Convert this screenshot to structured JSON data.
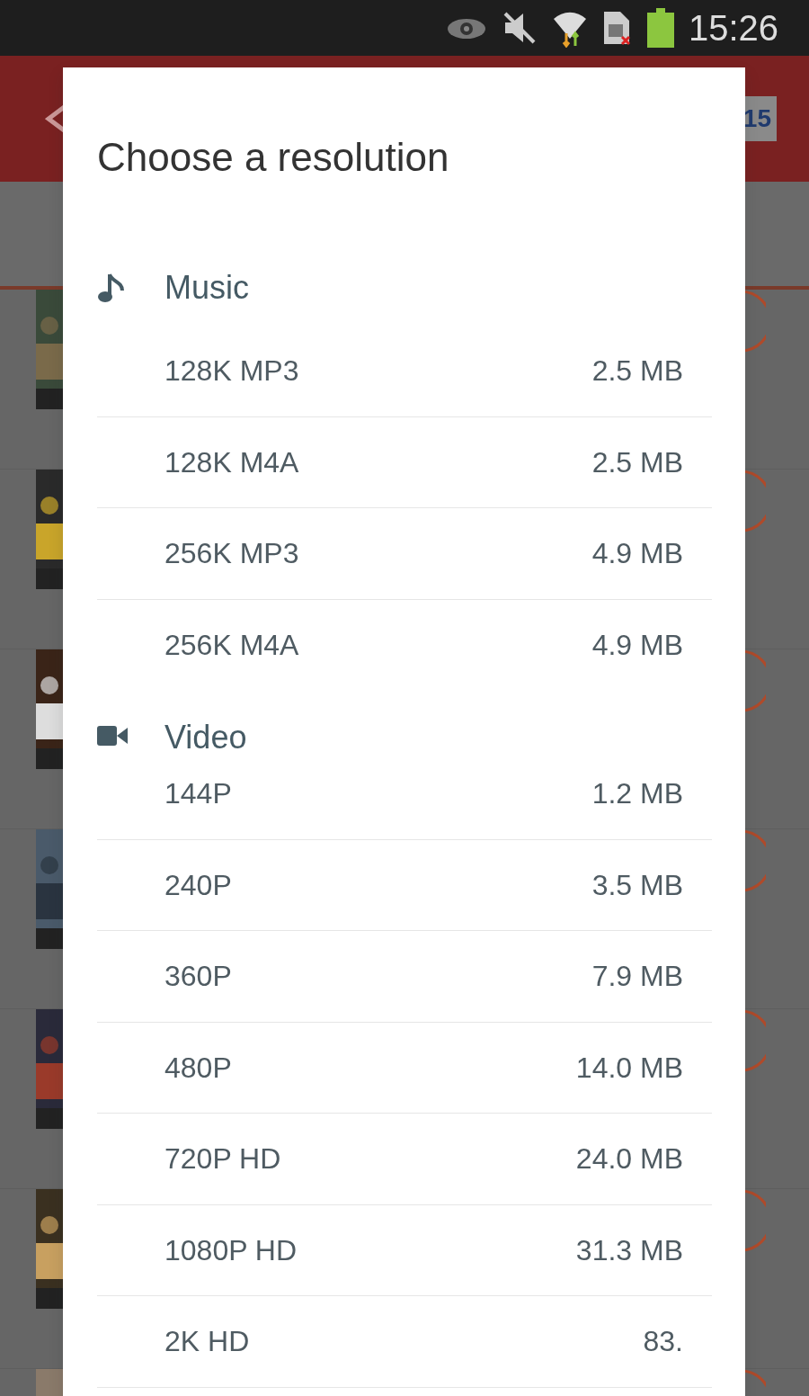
{
  "status_bar": {
    "time": "15:26"
  },
  "background": {
    "app_bar_text": "15",
    "list_rows": [
      {
        "kind": "video"
      },
      {
        "kind": "video"
      },
      {
        "kind": "video"
      },
      {
        "kind": "video"
      },
      {
        "kind": "video"
      },
      {
        "kind": "video"
      },
      {
        "kind": "video"
      }
    ]
  },
  "dialog": {
    "title": "Choose a resolution",
    "sections": [
      {
        "kind": "music",
        "label": "Music",
        "options": [
          {
            "name": "128K MP3",
            "size": "2.5 MB"
          },
          {
            "name": "128K M4A",
            "size": "2.5 MB"
          },
          {
            "name": "256K MP3",
            "size": "4.9 MB"
          },
          {
            "name": "256K M4A",
            "size": "4.9 MB"
          }
        ]
      },
      {
        "kind": "video",
        "label": "Video",
        "options": [
          {
            "name": "144P",
            "size": "1.2 MB"
          },
          {
            "name": "240P",
            "size": "3.5 MB"
          },
          {
            "name": "360P",
            "size": "7.9 MB"
          },
          {
            "name": "480P",
            "size": "14.0 MB"
          },
          {
            "name": "720P HD",
            "size": "24.0 MB"
          },
          {
            "name": "1080P HD",
            "size": "31.3 MB"
          },
          {
            "name": "2K HD",
            "size": "83."
          }
        ]
      }
    ]
  }
}
